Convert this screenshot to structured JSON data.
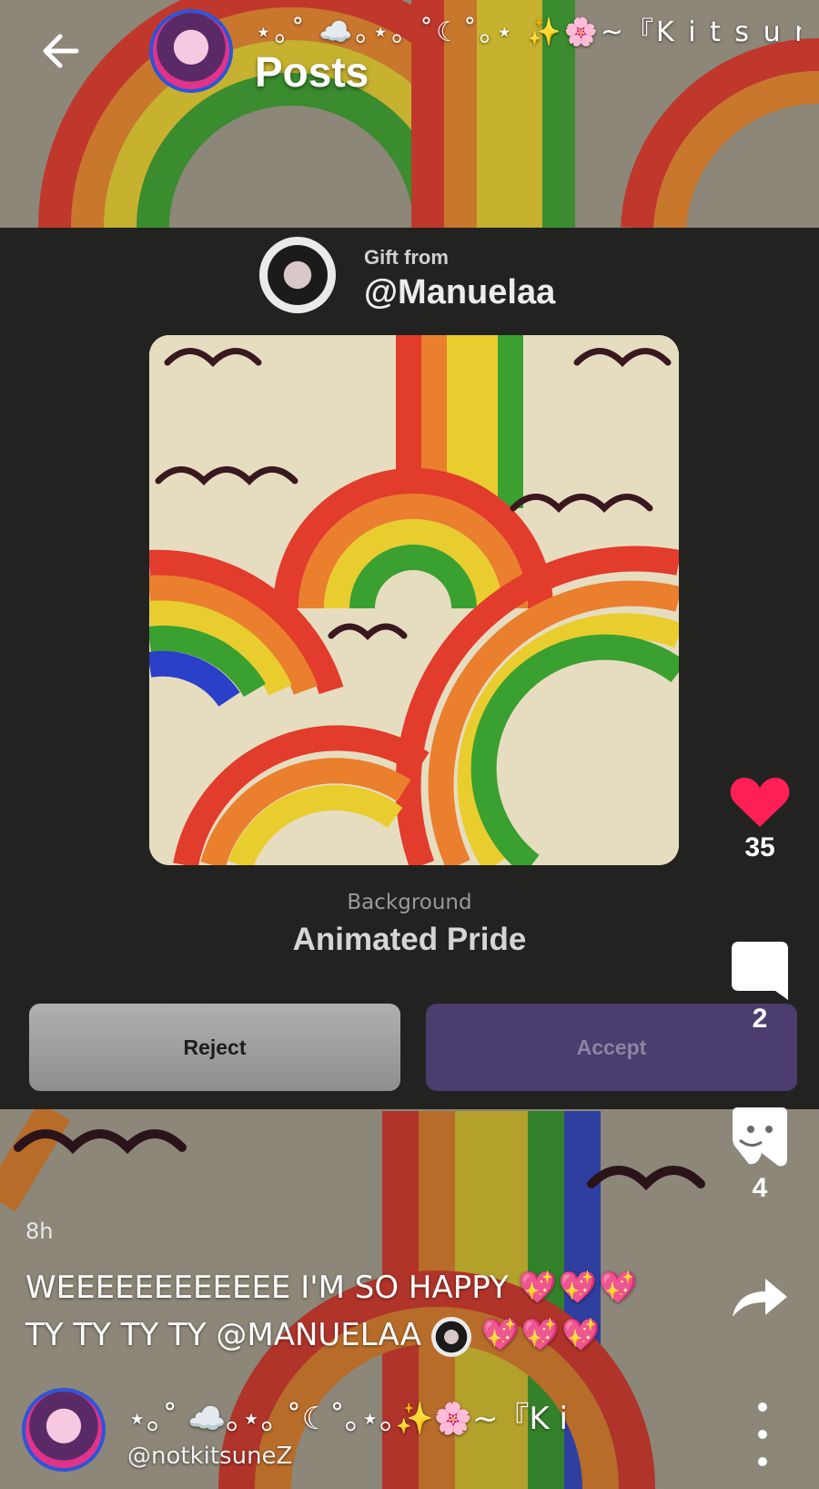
{
  "header": {
    "profile_name": "⋆｡˚ ☁️｡⋆｡ ˚☾˚｡⋆ ✨🌸~『K i t s u n e",
    "title": "Posts"
  },
  "gift": {
    "from_label": "Gift from",
    "from_user": "@Manuelaa",
    "item_type": "Background",
    "item_name": "Animated Pride",
    "reject_label": "Reject",
    "accept_label": "Accept"
  },
  "actions": {
    "likes": "35",
    "comments": "2",
    "props": "4"
  },
  "post": {
    "time": "8h",
    "line1_text": "WEEEEEEEEEEEE I'M SO HAPPY",
    "line1_emoji": "💖💖💖",
    "line2_text": "TY TY TY TY @MANUELAA",
    "line2_emoji": "💖💖💖"
  },
  "author": {
    "name": "⋆｡˚ ☁️｡⋆｡ ˚☾˚｡⋆｡✨🌸~『K i",
    "handle": "@notkitsuneZ"
  },
  "colors": {
    "card_bg": "#222321",
    "accept_bg": "#4b3d6d",
    "like": "#ff1f55"
  }
}
